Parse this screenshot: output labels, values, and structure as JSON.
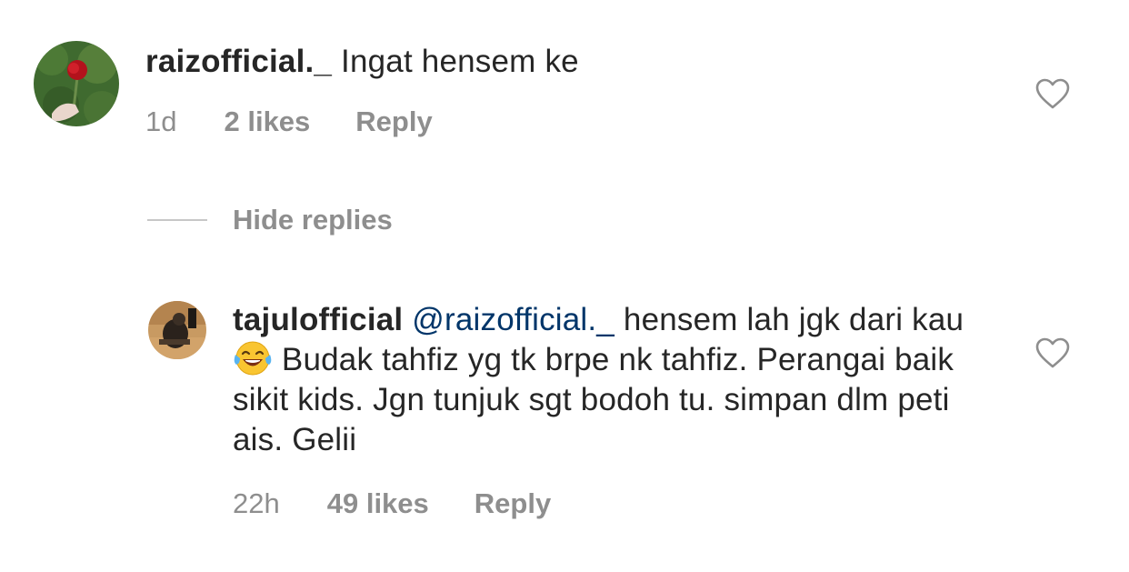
{
  "comment": {
    "username": "raizofficial._",
    "text": "Ingat hensem ke",
    "time": "1d",
    "likes": "2 likes",
    "reply_label": "Reply",
    "like_icon": "heart-outline-icon"
  },
  "hide_replies_label": "Hide replies",
  "reply": {
    "username": "tajulofficial",
    "mention": "@raizofficial._",
    "text_before_emoji": " hensem lah jgk dari kau",
    "emoji": "😂",
    "text_after_emoji": " Budak tahfiz yg tk brpe nk tahfiz. Perangai baik sikit kids. Jgn tunjuk sgt bodoh tu. simpan dlm peti ais. Gelii",
    "time": "22h",
    "likes": "49 likes",
    "reply_label": "Reply",
    "like_icon": "heart-outline-icon"
  },
  "colors": {
    "text": "#262626",
    "meta": "#8e8e8e",
    "mention": "#003569",
    "divider": "#c7c7c7"
  }
}
